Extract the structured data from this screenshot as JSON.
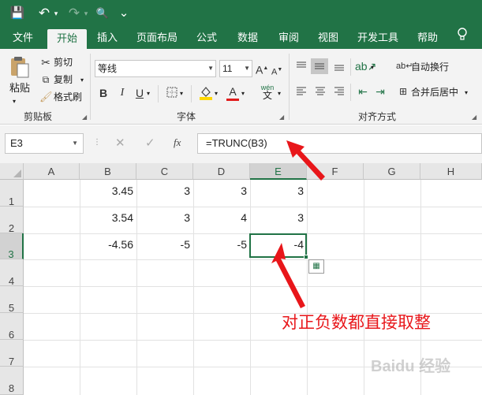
{
  "quick_access": {
    "save": "💾",
    "undo": "↶",
    "redo": "↷",
    "print_preview": "🔍",
    "more": "⌄"
  },
  "tabs": [
    "文件",
    "开始",
    "插入",
    "页面布局",
    "公式",
    "数据",
    "审阅",
    "视图",
    "开发工具",
    "帮助"
  ],
  "active_tab": "开始",
  "help_icon": "lightbulb-icon",
  "clipboard": {
    "paste": "粘贴",
    "cut": "剪切",
    "copy": "复制",
    "format_painter": "格式刷",
    "group": "剪贴板"
  },
  "font": {
    "name": "等线",
    "size": "11",
    "bold": "B",
    "italic": "I",
    "underline": "U",
    "phonetic_top": "wén",
    "phonetic_bottom": "文",
    "font_color_letter": "A",
    "group": "字体"
  },
  "alignment": {
    "wrap_text": "自动换行",
    "merge_center": "合并后居中",
    "group": "对齐方式"
  },
  "colors": {
    "brand": "#217346",
    "fill_yellow": "#ffd800",
    "font_red": "#e21c1c",
    "annotation": "#e8161a"
  },
  "name_box": "E3",
  "formula_icons": {
    "cancel": "✕",
    "enter": "✓",
    "fx": "fx"
  },
  "formula": "=TRUNC(B3)",
  "columns": [
    "A",
    "B",
    "C",
    "D",
    "E",
    "F",
    "G",
    "H"
  ],
  "selected_column": "E",
  "rows": [
    {
      "num": "1",
      "cells": [
        "",
        "3.45",
        "3",
        "3",
        "3"
      ]
    },
    {
      "num": "2",
      "cells": [
        "",
        "3.54",
        "3",
        "4",
        "3"
      ]
    },
    {
      "num": "3",
      "cells": [
        "",
        "-4.56",
        "-5",
        "-5",
        "-4"
      ]
    },
    {
      "num": "4",
      "cells": []
    },
    {
      "num": "5",
      "cells": []
    },
    {
      "num": "6",
      "cells": []
    },
    {
      "num": "7",
      "cells": []
    },
    {
      "num": "8",
      "cells": []
    }
  ],
  "selected_row": "3",
  "annotation": "对正负数都直接取整",
  "watermark": "Baidu 经验"
}
